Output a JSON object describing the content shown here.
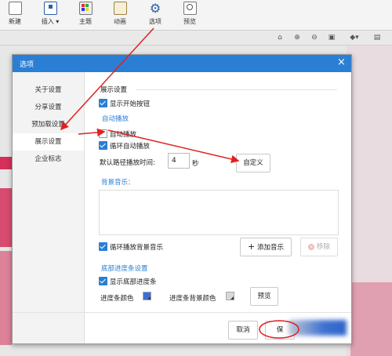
{
  "toolbar": {
    "items": [
      {
        "label": "新建",
        "icon": "new-page-icon"
      },
      {
        "label": "插入",
        "icon": "insert-icon"
      },
      {
        "label": "主题",
        "icon": "theme-icon"
      },
      {
        "label": "动画",
        "icon": "animation-icon"
      },
      {
        "label": "选项",
        "icon": "gear-icon"
      },
      {
        "label": "预览",
        "icon": "preview-icon"
      }
    ]
  },
  "dialog": {
    "title": "选项",
    "close_icon": "×",
    "sidebar": [
      "关于设置",
      "分享设置",
      "预加载设置",
      "展示设置",
      "企业标志"
    ],
    "active_tab": "展示设置",
    "section_title": "展示设置",
    "show_start_button": "显示开始按钮",
    "autoplay_header": "自动播放",
    "autoplay": "自动播放",
    "loop_autoplay": "循环自动播放",
    "default_interval_label": "默认路径播放时间:",
    "default_interval_value": "4",
    "interval_unit": "秒",
    "custom_button": "自定义",
    "bg_music_header": "背景音乐：",
    "loop_bg_music": "循环播放背景音乐",
    "add_music": "添加音乐",
    "remove_music": "移除",
    "progress_header": "底部进度条设置",
    "show_progress": "显示底部进度条",
    "progress_color": "进度条颜色",
    "progress_bg_color": "进度条背景颜色",
    "preview_button": "预览",
    "cancel_button": "取消",
    "ok_button": "保"
  },
  "colors": {
    "accent": "#2a7fd4",
    "annotation": "#e02020",
    "canvas_pink": "#d4305a",
    "progress_color": "#3b6fd6",
    "progress_bg_color": "#d8d8d8"
  }
}
